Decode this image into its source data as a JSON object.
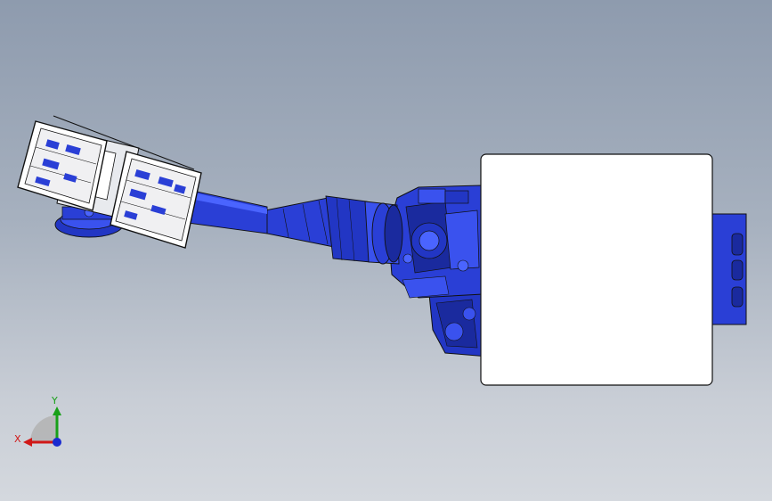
{
  "viewport": {
    "background_top": "#8e9bae",
    "background_bottom": "#d4d8de"
  },
  "model": {
    "part_color": "#2a3fd6",
    "part_shade": "#1a2a9e",
    "part_highlight": "#4a64ff",
    "panel_color": "#ffffff",
    "outline_color": "#111111"
  },
  "triad": {
    "x_label": "X",
    "y_label": "Y",
    "x_color": "#d01818",
    "y_color": "#18a018",
    "z_color": "#1a2ad0"
  }
}
